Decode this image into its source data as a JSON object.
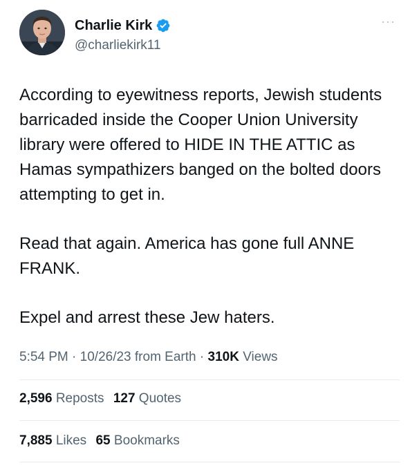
{
  "author": {
    "display_name": "Charlie Kirk",
    "handle": "@charliekirk11",
    "verified_icon": "verified-badge-icon",
    "avatar_icon": "avatar-photo"
  },
  "more_icon": "more-options-icon",
  "more_glyph": "···",
  "body": [
    "According to eyewitness reports, Jewish students barricaded inside the Cooper Union University library were offered to HIDE IN THE ATTIC as Hamas sympathizers banged on the bolted doors attempting to get in.",
    "Read that again. America has gone full ANNE FRANK.",
    "Expel and arrest these Jew haters."
  ],
  "meta": {
    "time": "5:54 PM",
    "sep1": "·",
    "date": "10/26/23",
    "source": "from Earth",
    "sep2": "·",
    "views_count": "310K",
    "views_label": "Views"
  },
  "stats": {
    "reposts_count": "2,596",
    "reposts_label": "Reposts",
    "quotes_count": "127",
    "quotes_label": "Quotes",
    "likes_count": "7,885",
    "likes_label": "Likes",
    "bookmarks_count": "65",
    "bookmarks_label": "Bookmarks"
  },
  "colors": {
    "verified_blue": "#1d9bf0",
    "secondary_text": "#536471",
    "primary_text": "#0f1419"
  }
}
